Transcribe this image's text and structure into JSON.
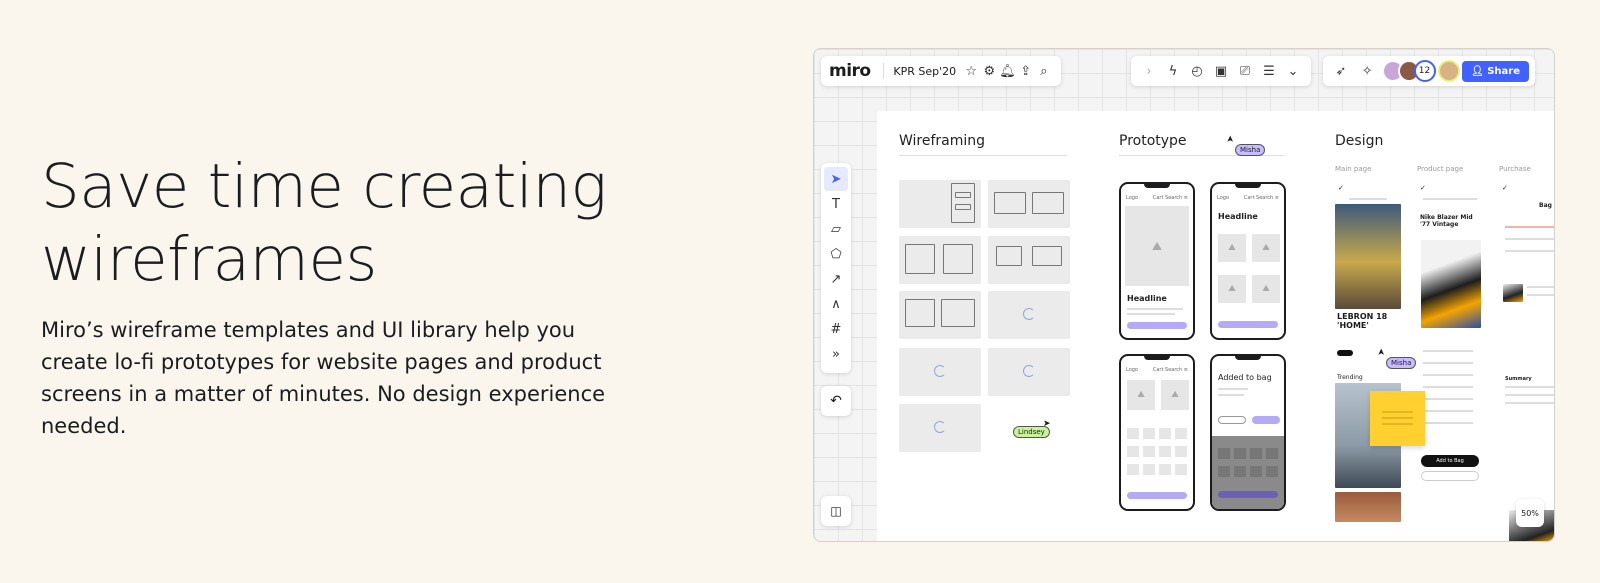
{
  "hero": {
    "title_line1": "Save time creating",
    "title_line2": "wireframes",
    "description": "Miro’s wireframe templates and UI library help you create lo-fi prototypes for website pages and product screens in a matter of minutes. No design experience needed."
  },
  "board": {
    "logo": "miro",
    "board_name": "KPR Sep'20",
    "collaborator_count": "12",
    "share_label": "Share",
    "zoom_level": "50%",
    "accent_color": "#4262ff",
    "sections": {
      "wireframing": "Wireframing",
      "prototype": "Prototype",
      "design": "Design"
    },
    "design_columns": [
      "Main page",
      "Product page",
      "Purchase"
    ],
    "cursors": {
      "misha": "Misha",
      "misha2": "Misha",
      "lindsey": "Lindsey"
    },
    "phones": {
      "logo": "Logo",
      "cart": "Cart",
      "search": "Search",
      "headline": "Headline",
      "added_to_bag": "Added to bag"
    },
    "design": {
      "lebron": "LEBRON 18 'HOME'",
      "product": "Nike Blazer Mid '77 Vintage",
      "trending": "Trending",
      "add_to_bag": "Add to Bag",
      "bag": "Bag",
      "summary": "Summary"
    },
    "icons": {
      "toolbar": [
        "chevron-right-icon",
        "bolt-icon",
        "timer-icon",
        "card-icon",
        "present-icon",
        "notes-icon",
        "more-icon"
      ],
      "tools": [
        "cursor-icon",
        "text-icon",
        "sticky-note-icon",
        "shapes-icon",
        "arrow-icon",
        "pen-icon",
        "frame-icon",
        "more-tools-icon"
      ]
    }
  }
}
